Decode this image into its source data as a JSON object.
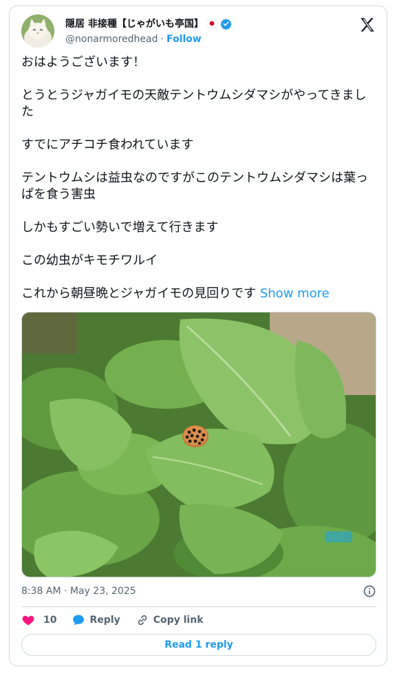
{
  "author": {
    "display_name": "隠居 非接種【じゃがいも亭国】",
    "handle": "@nonarmoredhead",
    "separator": "·",
    "follow_label": "Follow"
  },
  "tweet": {
    "paragraphs": [
      "おはようございます！",
      "とうとうジャガイモの天敵テントウムシダマシがやってきました",
      "すでにアチコチ食われています",
      "テントウムシは益虫なのですがこのテントウムシダマシは葉っぱを食う害虫",
      "しかもすごい勢いで増えて行きます",
      "この幼虫がキモチワルイ"
    ],
    "last_paragraph": "これから朝昼晩とジャガイモの見回りです",
    "show_more_label": "Show more",
    "timestamp": "8:38 AM · May 23, 2025"
  },
  "actions": {
    "like_count": "10",
    "reply_label": "Reply",
    "copy_link_label": "Copy link"
  },
  "read_reply_label": "Read 1 reply",
  "colors": {
    "accent": "#1d9bf0",
    "like": "#f91880",
    "text": "#0f1419",
    "secondary": "#536471",
    "border": "#cfd9de"
  },
  "icons": [
    "avatar-cat",
    "japan-flag-icon",
    "verified-badge-icon",
    "x-logo-icon",
    "info-icon",
    "heart-icon",
    "reply-bubble-icon",
    "link-icon"
  ]
}
